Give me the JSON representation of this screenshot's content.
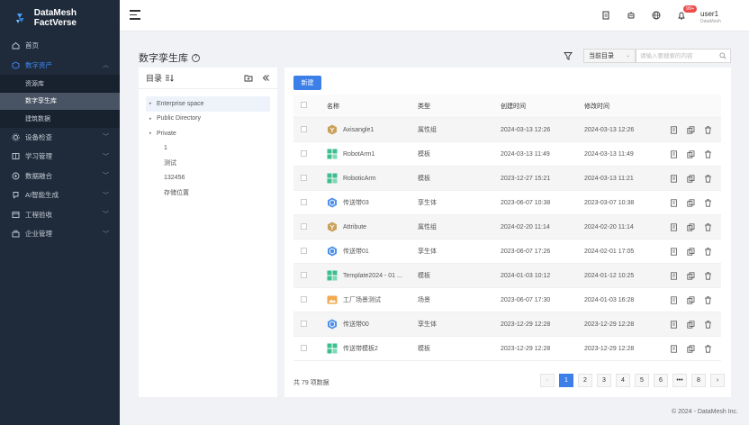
{
  "app": {
    "name": "DataMesh FactVerse"
  },
  "sidebar": {
    "items": [
      {
        "label": "首页",
        "icon": "home-icon"
      },
      {
        "label": "数字资产",
        "icon": "asset-icon",
        "expanded": true,
        "children": [
          {
            "label": "资源库"
          },
          {
            "label": "数字孪生库",
            "active": true
          },
          {
            "label": "建筑数据"
          }
        ]
      },
      {
        "label": "设备检查",
        "icon": "check-icon"
      },
      {
        "label": "学习管理",
        "icon": "book-icon"
      },
      {
        "label": "数据融合",
        "icon": "data-icon"
      },
      {
        "label": "AI智能生成",
        "icon": "ai-icon"
      },
      {
        "label": "工程验收",
        "icon": "acceptance-icon"
      },
      {
        "label": "企业管理",
        "icon": "enterprise-icon"
      }
    ]
  },
  "header": {
    "badge": "99+",
    "user_name": "user1",
    "user_org": "DataMesh"
  },
  "page": {
    "title": "数字孪生库",
    "scope": "当前目录",
    "search_placeholder": "请输入要搜索的内容"
  },
  "directory": {
    "title": "目录",
    "nodes": [
      {
        "label": "Enterprise space",
        "caret": true,
        "selected": true
      },
      {
        "label": "Public Directory",
        "caret": true
      },
      {
        "label": "Private",
        "caret": true
      },
      {
        "label": "1"
      },
      {
        "label": "测试"
      },
      {
        "label": "132456"
      },
      {
        "label": "存储位置"
      }
    ]
  },
  "table": {
    "new_label": "新建",
    "columns": [
      "名称",
      "类型",
      "创建时间",
      "修改时间"
    ],
    "rows": [
      {
        "name": "Axisangle1",
        "type": "属性组",
        "created": "2024-03-13 12:26",
        "modified": "2024-03-13 12:26",
        "icon": "property-group-icon"
      },
      {
        "name": "RobotArm1",
        "type": "模板",
        "created": "2024-03-13 11:49",
        "modified": "2024-03-13 11:49",
        "icon": "template-icon"
      },
      {
        "name": "RoboticArm",
        "type": "模板",
        "created": "2023-12-27 15:21",
        "modified": "2024-03-13 11:21",
        "icon": "template-icon"
      },
      {
        "name": "传送带03",
        "type": "孪生体",
        "created": "2023-06-07 10:38",
        "modified": "2023-03-07 10:38",
        "icon": "twin-icon"
      },
      {
        "name": "Attribute",
        "type": "属性组",
        "created": "2024-02-20 11:14",
        "modified": "2024-02-20 11:14",
        "icon": "property-group-icon"
      },
      {
        "name": "传送带01",
        "type": "孪生体",
        "created": "2023-06-07 17:26",
        "modified": "2024-02-01 17:05",
        "icon": "twin-icon"
      },
      {
        "name": "Template2024 - 01 ...",
        "type": "模板",
        "created": "2024-01-03 10:12",
        "modified": "2024-01-12 10:25",
        "icon": "template-icon"
      },
      {
        "name": "工厂场景测试",
        "type": "场景",
        "created": "2023-06-07 17:30",
        "modified": "2024-01-03 16:28",
        "icon": "scene-icon"
      },
      {
        "name": "传送带00",
        "type": "孪生体",
        "created": "2023-12-29 12:28",
        "modified": "2023-12-29 12:28",
        "icon": "twin-icon"
      },
      {
        "name": "传送带模板2",
        "type": "模板",
        "created": "2023-12-29 12:28",
        "modified": "2023-12-29 12:28",
        "icon": "template-icon"
      }
    ],
    "total": "共 79 项数据"
  },
  "pagination": {
    "prev": "‹",
    "pages": [
      "1",
      "2",
      "3",
      "4",
      "5",
      "6",
      "•••",
      "8"
    ],
    "current": "1",
    "next": "›"
  },
  "footer": {
    "copyright": "© 2024 - DataMesh Inc."
  },
  "colors": {
    "sidebar_bg": "#1f2b3a",
    "accent": "#3d7fe8",
    "badge": "#f04b4b"
  }
}
